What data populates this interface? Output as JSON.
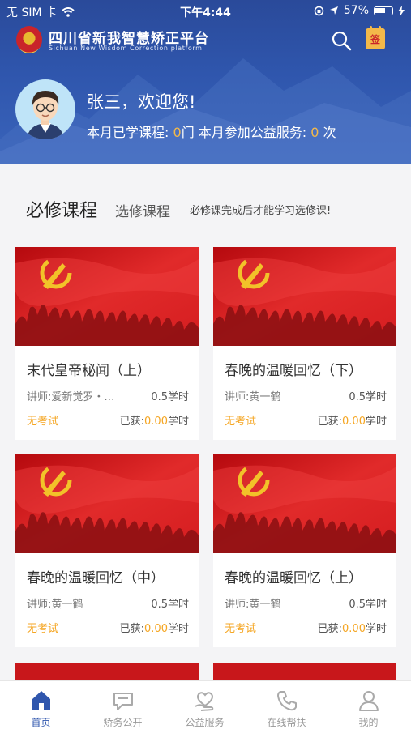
{
  "status_bar": {
    "carrier": "无 SIM 卡",
    "time": "下午4:44",
    "battery": "57%"
  },
  "app": {
    "title": "四川省新我智慧矫正平台",
    "subtitle": "Sichuan New Wisdom Correction platform",
    "sign_label": "签"
  },
  "user": {
    "welcome": "张三，欢迎您!",
    "courses_label": "本月已学课程:",
    "courses_count": "0",
    "courses_unit": "门",
    "service_label": "本月参加公益服务:",
    "service_count": "0",
    "service_unit": "次"
  },
  "course_tabs": {
    "active": "必修课程",
    "other": "选修课程",
    "hint": "必修课完成后才能学习选修课!"
  },
  "courses": [
    {
      "title": "末代皇帝秘闻（上）",
      "teacher": "讲师:爱新觉罗・…",
      "hours": "0.5学时",
      "exam": "无考试",
      "got_label": "已获:",
      "got_value": "0.00",
      "got_unit": "学时"
    },
    {
      "title": "春晚的温暖回忆（下）",
      "teacher": "讲师:黄一鹤",
      "hours": "0.5学时",
      "exam": "无考试",
      "got_label": "已获:",
      "got_value": "0.00",
      "got_unit": "学时"
    },
    {
      "title": "春晚的温暖回忆（中）",
      "teacher": "讲师:黄一鹤",
      "hours": "0.5学时",
      "exam": "无考试",
      "got_label": "已获:",
      "got_value": "0.00",
      "got_unit": "学时"
    },
    {
      "title": "春晚的温暖回忆（上）",
      "teacher": "讲师:黄一鹤",
      "hours": "0.5学时",
      "exam": "无考试",
      "got_label": "已获:",
      "got_value": "0.00",
      "got_unit": "学时"
    }
  ],
  "nav": [
    {
      "label": "首页",
      "icon": "home-icon"
    },
    {
      "label": "矫务公开",
      "icon": "message-icon"
    },
    {
      "label": "公益服务",
      "icon": "heart-hand-icon"
    },
    {
      "label": "在线帮扶",
      "icon": "phone-icon"
    },
    {
      "label": "我的",
      "icon": "user-icon"
    }
  ],
  "colors": {
    "header": "#2f56ad",
    "accent": "#f5a623",
    "nav_active": "#2f56ad"
  }
}
